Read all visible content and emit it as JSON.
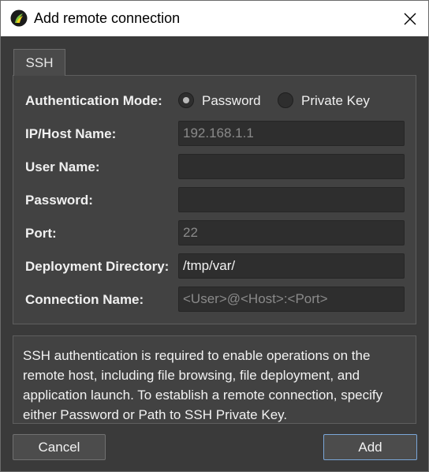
{
  "window": {
    "title": "Add remote connection",
    "icon": "app-logo-icon",
    "close_icon": "close-icon"
  },
  "tabs": [
    {
      "label": "SSH",
      "active": true
    }
  ],
  "form": {
    "auth_mode": {
      "label": "Authentication Mode:",
      "options": [
        {
          "label": "Password",
          "selected": true
        },
        {
          "label": "Private Key",
          "selected": false
        }
      ]
    },
    "host": {
      "label": "IP/Host Name:",
      "value": "",
      "placeholder": "192.168.1.1"
    },
    "user": {
      "label": "User Name:",
      "value": "",
      "placeholder": ""
    },
    "password": {
      "label": "Password:",
      "value": "",
      "placeholder": ""
    },
    "port": {
      "label": "Port:",
      "value": "",
      "placeholder": "22"
    },
    "deploy_dir": {
      "label": "Deployment Directory:",
      "value": "/tmp/var/",
      "placeholder": ""
    },
    "conn_name": {
      "label": "Connection Name:",
      "value": "",
      "placeholder": "<User>@<Host>:<Port>"
    }
  },
  "info": {
    "line1": "SSH authentication is required to enable operations on the",
    "line2": "remote host, including file browsing, file deployment, and",
    "line3": "application launch. To establish a remote connection, specify",
    "line4": "either Password or Path to SSH Private Key."
  },
  "buttons": {
    "cancel": "Cancel",
    "add": "Add"
  },
  "colors": {
    "background": "#3a3a3a",
    "panel": "#424242",
    "field": "#2e2e2e",
    "default_button_border": "#7aa6d8"
  }
}
